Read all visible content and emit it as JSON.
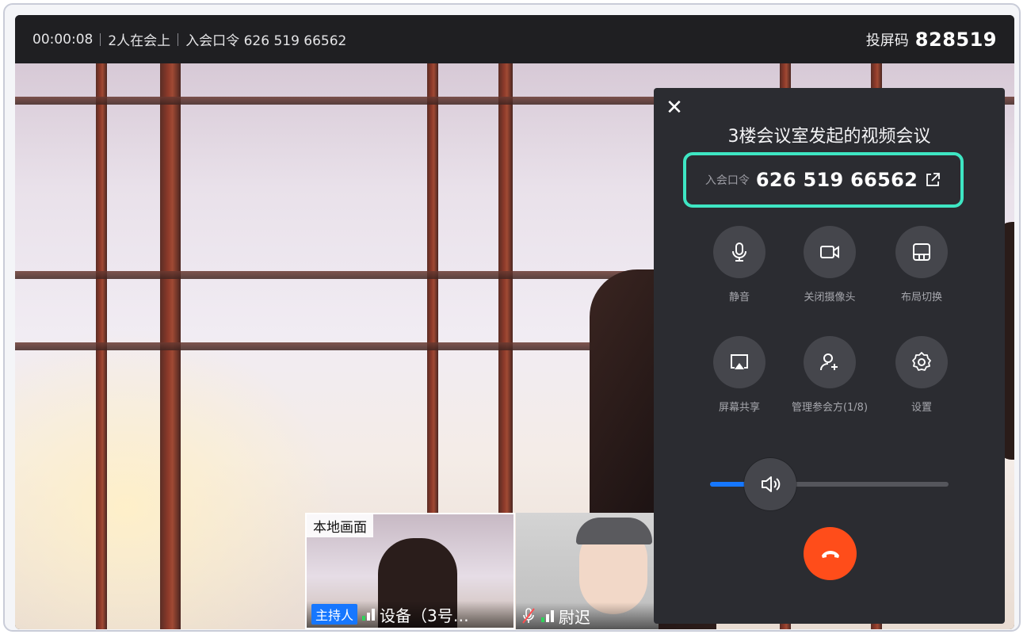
{
  "topbar": {
    "duration": "00:00:08",
    "participants": "2人在会上",
    "passcode_text": "入会口令 626 519 66562",
    "cast_label": "投屏码",
    "cast_code": "828519"
  },
  "panel": {
    "title": "3楼会议室发起的视频会议",
    "passcode_label": "入会口令",
    "passcode": "626 519 66562",
    "controls": [
      {
        "label": "静音",
        "icon": "microphone-icon"
      },
      {
        "label": "关闭摄像头",
        "icon": "camera-icon"
      },
      {
        "label": "布局切换",
        "icon": "layout-icon"
      },
      {
        "label": "屏幕共享",
        "icon": "screen-share-icon"
      },
      {
        "label": "管理参会方(1/8)",
        "icon": "add-participant-icon"
      },
      {
        "label": "设置",
        "icon": "gear-icon"
      }
    ],
    "volume": 0.18
  },
  "thumbnails": {
    "local": {
      "label": "本地画面",
      "host_badge": "主持人",
      "name": "设备（3号…"
    },
    "remote": {
      "name": "尉迟"
    }
  },
  "colors": {
    "accent": "#1677ff",
    "highlight": "#3ee6c3",
    "hangup": "#ff4d1a",
    "panel": "#2b2c31"
  }
}
